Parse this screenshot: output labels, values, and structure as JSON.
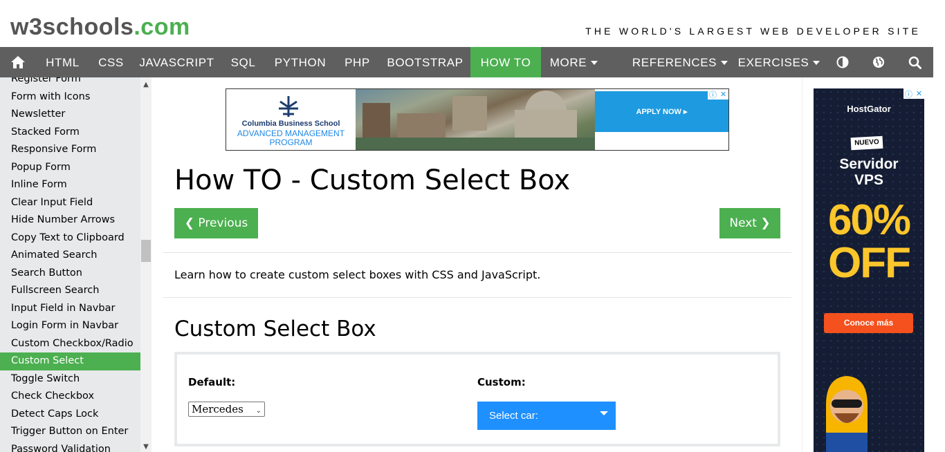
{
  "header": {
    "logo_main": "w3schools",
    "logo_tld": ".com",
    "tagline": "THE WORLD'S LARGEST WEB DEVELOPER SITE"
  },
  "navbar": {
    "items": [
      {
        "label": "HTML"
      },
      {
        "label": "CSS"
      },
      {
        "label": "JAVASCRIPT"
      },
      {
        "label": "SQL"
      },
      {
        "label": "PYTHON"
      },
      {
        "label": "PHP"
      },
      {
        "label": "BOOTSTRAP"
      },
      {
        "label": "HOW TO",
        "active": true
      },
      {
        "label": "MORE"
      },
      {
        "label": "REFERENCES"
      },
      {
        "label": "EXERCISES"
      }
    ],
    "icons": [
      "home-icon",
      "contrast-icon",
      "globe-icon",
      "search-icon"
    ],
    "accent_color": "#4CAF50",
    "bar_color": "#5f5f5f"
  },
  "sidebar": {
    "items": [
      "Register Form",
      "Form with Icons",
      "Newsletter",
      "Stacked Form",
      "Responsive Form",
      "Popup Form",
      "Inline Form",
      "Clear Input Field",
      "Hide Number Arrows",
      "Copy Text to Clipboard",
      "Animated Search",
      "Search Button",
      "Fullscreen Search",
      "Input Field in Navbar",
      "Login Form in Navbar",
      "Custom Checkbox/Radio",
      "Custom Select",
      "Toggle Switch",
      "Check Checkbox",
      "Detect Caps Lock",
      "Trigger Button on Enter",
      "Password Validation"
    ],
    "active_index": 16
  },
  "ad_top": {
    "school": "Columbia Business School",
    "program": "ADVANCED MANAGEMENT PROGRAM",
    "cta": "APPLY NOW ▸"
  },
  "main": {
    "title": "How TO - Custom Select Box",
    "prev_label": "❮ Previous",
    "next_label": "Next ❯",
    "intro": "Learn how to create custom select boxes with CSS and JavaScript.",
    "section_title": "Custom Select Box",
    "example": {
      "default_label": "Default:",
      "default_value": "Mercedes",
      "custom_label": "Custom:",
      "custom_value": "Select car:",
      "custom_color": "#1e90ff"
    }
  },
  "ad_side": {
    "brand": "HostGator",
    "badge": "NUEVO",
    "product_line1": "Servidor",
    "product_line2": "VPS",
    "discount_line1": "60%",
    "discount_line2": "OFF",
    "cta": "Conoce más"
  }
}
